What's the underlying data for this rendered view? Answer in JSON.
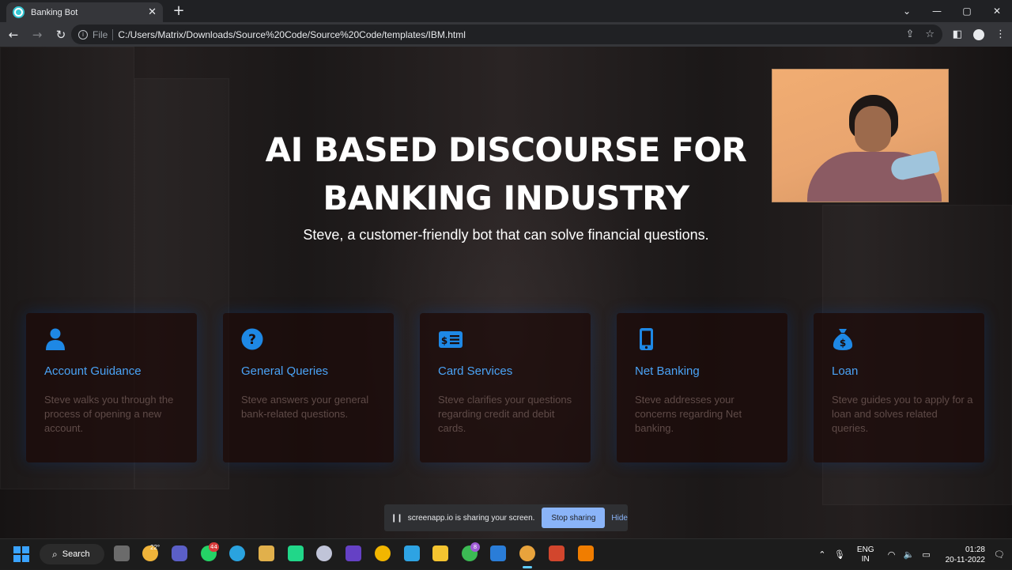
{
  "browser": {
    "tab_title": "Banking Bot",
    "tab_close": "✕",
    "new_tab": "+",
    "scheme": "File",
    "url": "C:/Users/Matrix/Downloads/Source%20Code/Source%20Code/templates/IBM.html",
    "window_controls": {
      "collapse": "⌄",
      "minimize": "—",
      "maximize": "▢",
      "close": "✕"
    }
  },
  "hero": {
    "title_line1": "AI BASED DISCOURSE FOR",
    "title_line2": "BANKING INDUSTRY",
    "subtitle": "Steve, a customer-friendly bot that can solve financial questions."
  },
  "cards": [
    {
      "icon": "user-icon",
      "title": "Account Guidance",
      "text": "Steve walks you through the process of opening a new account."
    },
    {
      "icon": "question-icon",
      "title": "General Queries",
      "text": "Steve answers your general bank-related questions."
    },
    {
      "icon": "credit-card-icon",
      "title": "Card Services",
      "text": "Steve clarifies your questions regarding credit and debit cards."
    },
    {
      "icon": "mobile-phone-icon",
      "title": "Net Banking",
      "text": "Steve addresses your concerns regarding Net banking."
    },
    {
      "icon": "money-bag-icon",
      "title": "Loan",
      "text": "Steve guides you to apply for a loan and solves related queries."
    }
  ],
  "share_bar": {
    "message": "screenapp.io is sharing your screen.",
    "stop_label": "Stop sharing",
    "hide_label": "Hide"
  },
  "taskbar": {
    "search_label": "Search",
    "weather_temp": "22°",
    "whatsapp_badge": "44",
    "chrome_badge": "8",
    "language_line1": "ENG",
    "language_line2": "IN",
    "time": "01:28",
    "date": "20-11-2022"
  },
  "colors": {
    "accent": "#4aa3f6",
    "card_text": "#5f4b48",
    "stop_button": "#8ab4f8"
  }
}
